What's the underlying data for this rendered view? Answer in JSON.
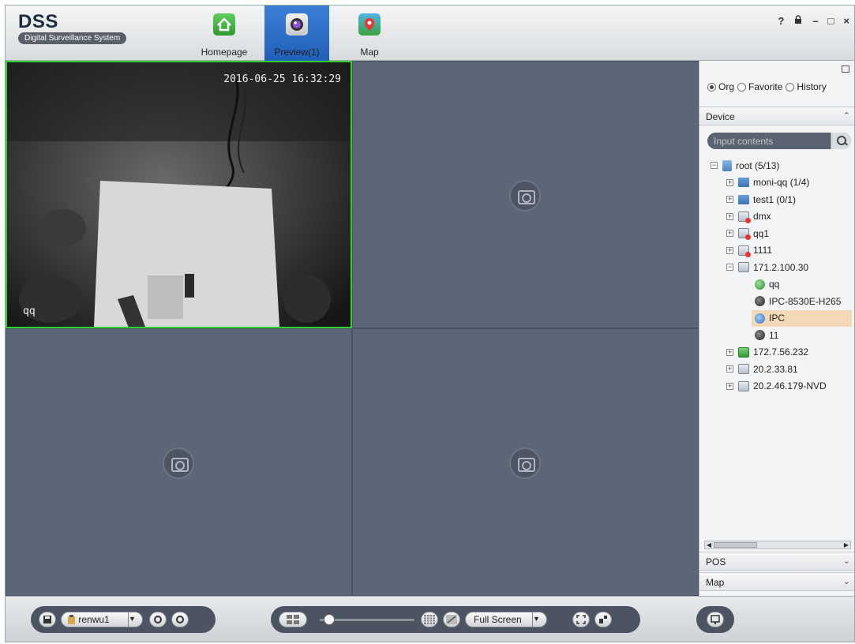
{
  "app": {
    "logo_title": "DSS",
    "logo_subtitle": "Digital Surveillance System"
  },
  "nav": {
    "homepage": "Homepage",
    "preview": "Preview(1)",
    "map": "Map"
  },
  "window_controls": {
    "help": "?",
    "lock": "⌂",
    "minimize": "–",
    "maximize": "□",
    "close": "×"
  },
  "video": {
    "timestamp": "2016-06-25 16:32:29",
    "channel_name": "qq"
  },
  "side": {
    "radio_org": "Org",
    "radio_favorite": "Favorite",
    "radio_history": "History",
    "device_header": "Device",
    "search_placeholder": "Input contents",
    "pos_header": "POS",
    "map_header": "Map"
  },
  "tree": {
    "root": "root (5/13)",
    "moni_qq": "moni-qq (1/4)",
    "test1": "test1 (0/1)",
    "dmx": "dmx",
    "qq1": "qq1",
    "n1111": "1111",
    "dev_171": "171.2.100.30",
    "ch_qq": "qq",
    "ch_ipc8530": "IPC-8530E-H265",
    "ch_ipc": "IPC",
    "ch_11": "11",
    "dev_172": "172.7.56.232",
    "dev_20_2_33": "20.2.33.81",
    "dev_nvd": "20.2.46.179-NVD"
  },
  "toolbar": {
    "view_name": "renwu1",
    "full_screen": "Full Screen"
  },
  "colors": {
    "accent_blue": "#1f5fb8",
    "video_bg": "#5c6676",
    "active_border": "#2fd12f",
    "selected_row": "#f3d9b8"
  }
}
